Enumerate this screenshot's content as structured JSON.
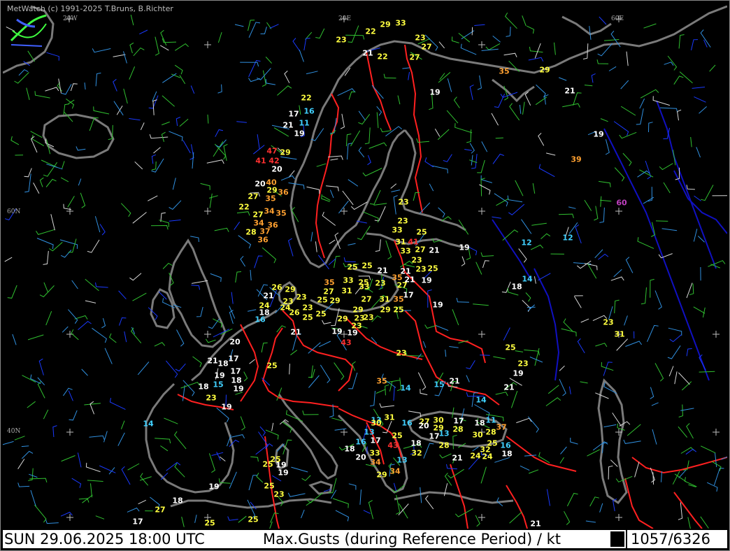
{
  "app": {
    "credit": "MetWatch  (c) 1991-2025 T.Bruns, B.Richter"
  },
  "footer": {
    "datetime": "SUN 29.06.2025 18:00 UTC",
    "parameter": "Max.Gusts (during Reference Period) / kt",
    "count": "1057/6326"
  },
  "grid_labels": {
    "lon_20w": "20W",
    "lon_20e": "20E",
    "lon_60e": "60E",
    "lat_60n": "60N",
    "lat_40n": "40N"
  },
  "colors": {
    "white": "#ffffff",
    "yellow": "#ffff40",
    "orange": "#ffa030",
    "red": "#ff3030",
    "cyan": "#40d0ff",
    "purple": "#c040c0",
    "border_red": "#ff2020",
    "coast": "#808080",
    "shore_blue": "#1010c0"
  },
  "observations": [
    {
      "v": "23",
      "c": "yellow"
    },
    {
      "v": "22",
      "c": "yellow"
    },
    {
      "v": "29",
      "c": "yellow"
    },
    {
      "v": "33",
      "c": "yellow"
    },
    {
      "v": "23",
      "c": "yellow"
    },
    {
      "v": "27",
      "c": "yellow"
    },
    {
      "v": "21",
      "c": "white"
    },
    {
      "v": "22",
      "c": "yellow"
    },
    {
      "v": "27",
      "c": "yellow"
    },
    {
      "v": "35",
      "c": "orange"
    },
    {
      "v": "29",
      "c": "yellow"
    },
    {
      "v": "21",
      "c": "white"
    },
    {
      "v": "19",
      "c": "white"
    },
    {
      "v": "22",
      "c": "yellow"
    },
    {
      "v": "17",
      "c": "white"
    },
    {
      "v": "16",
      "c": "cyan"
    },
    {
      "v": "21",
      "c": "white"
    },
    {
      "v": "11",
      "c": "cyan"
    },
    {
      "v": "19",
      "c": "white"
    },
    {
      "v": "19",
      "c": "white"
    },
    {
      "v": "47",
      "c": "red"
    },
    {
      "v": "29",
      "c": "yellow"
    },
    {
      "v": "41",
      "c": "red"
    },
    {
      "v": "42",
      "c": "red"
    },
    {
      "v": "20",
      "c": "white"
    },
    {
      "v": "39",
      "c": "orange"
    },
    {
      "v": "20",
      "c": "white"
    },
    {
      "v": "40",
      "c": "orange"
    },
    {
      "v": "29",
      "c": "yellow"
    },
    {
      "v": "36",
      "c": "orange"
    },
    {
      "v": "27",
      "c": "yellow"
    },
    {
      "v": "35",
      "c": "orange"
    },
    {
      "v": "22",
      "c": "yellow"
    },
    {
      "v": "34",
      "c": "orange"
    },
    {
      "v": "35",
      "c": "orange"
    },
    {
      "v": "60",
      "c": "purple"
    },
    {
      "v": "27",
      "c": "yellow"
    },
    {
      "v": "23",
      "c": "yellow"
    },
    {
      "v": "34",
      "c": "orange"
    },
    {
      "v": "36",
      "c": "orange"
    },
    {
      "v": "23",
      "c": "yellow"
    },
    {
      "v": "28",
      "c": "yellow"
    },
    {
      "v": "37",
      "c": "orange"
    },
    {
      "v": "33",
      "c": "yellow"
    },
    {
      "v": "25",
      "c": "yellow"
    },
    {
      "v": "36",
      "c": "orange"
    },
    {
      "v": "31",
      "c": "yellow"
    },
    {
      "v": "41",
      "c": "red"
    },
    {
      "v": "33",
      "c": "yellow"
    },
    {
      "v": "27",
      "c": "yellow"
    },
    {
      "v": "21",
      "c": "white"
    },
    {
      "v": "19",
      "c": "white"
    },
    {
      "v": "12",
      "c": "cyan"
    },
    {
      "v": "12",
      "c": "cyan"
    },
    {
      "v": "23",
      "c": "yellow"
    },
    {
      "v": "25",
      "c": "yellow"
    },
    {
      "v": "25",
      "c": "yellow"
    },
    {
      "v": "25",
      "c": "yellow"
    },
    {
      "v": "21",
      "c": "white"
    },
    {
      "v": "21",
      "c": "white"
    },
    {
      "v": "23",
      "c": "yellow"
    },
    {
      "v": "35",
      "c": "orange"
    },
    {
      "v": "33",
      "c": "yellow"
    },
    {
      "v": "25",
      "c": "yellow"
    },
    {
      "v": "35",
      "c": "orange"
    },
    {
      "v": "21",
      "c": "white"
    },
    {
      "v": "19",
      "c": "white"
    },
    {
      "v": "14",
      "c": "cyan"
    },
    {
      "v": "27",
      "c": "yellow"
    },
    {
      "v": "31",
      "c": "yellow"
    },
    {
      "v": "33",
      "c": "yellow"
    },
    {
      "v": "23",
      "c": "yellow"
    },
    {
      "v": "27",
      "c": "yellow"
    },
    {
      "v": "18",
      "c": "white"
    },
    {
      "v": "21",
      "c": "white"
    },
    {
      "v": "26",
      "c": "yellow"
    },
    {
      "v": "29",
      "c": "yellow"
    },
    {
      "v": "23",
      "c": "yellow"
    },
    {
      "v": "25",
      "c": "yellow"
    },
    {
      "v": "29",
      "c": "yellow"
    },
    {
      "v": "27",
      "c": "yellow"
    },
    {
      "v": "31",
      "c": "yellow"
    },
    {
      "v": "35",
      "c": "orange"
    },
    {
      "v": "17",
      "c": "white"
    },
    {
      "v": "24",
      "c": "yellow"
    },
    {
      "v": "23",
      "c": "yellow"
    },
    {
      "v": "23",
      "c": "yellow"
    },
    {
      "v": "29",
      "c": "yellow"
    },
    {
      "v": "29",
      "c": "yellow"
    },
    {
      "v": "25",
      "c": "yellow"
    },
    {
      "v": "19",
      "c": "white"
    },
    {
      "v": "18",
      "c": "white"
    },
    {
      "v": "24",
      "c": "yellow"
    },
    {
      "v": "26",
      "c": "yellow"
    },
    {
      "v": "25",
      "c": "yellow"
    },
    {
      "v": "25",
      "c": "yellow"
    },
    {
      "v": "23",
      "c": "yellow"
    },
    {
      "v": "23",
      "c": "yellow"
    },
    {
      "v": "16",
      "c": "cyan"
    },
    {
      "v": "29",
      "c": "yellow"
    },
    {
      "v": "23",
      "c": "yellow"
    },
    {
      "v": "19",
      "c": "white"
    },
    {
      "v": "19",
      "c": "white"
    },
    {
      "v": "23",
      "c": "yellow"
    },
    {
      "v": "31",
      "c": "yellow"
    },
    {
      "v": "21",
      "c": "white"
    },
    {
      "v": "20",
      "c": "white"
    },
    {
      "v": "43",
      "c": "red"
    },
    {
      "v": "25",
      "c": "yellow"
    },
    {
      "v": "17",
      "c": "white"
    },
    {
      "v": "23",
      "c": "yellow"
    },
    {
      "v": "23",
      "c": "yellow"
    },
    {
      "v": "21",
      "c": "white"
    },
    {
      "v": "18",
      "c": "white"
    },
    {
      "v": "25",
      "c": "yellow"
    },
    {
      "v": "19",
      "c": "white"
    },
    {
      "v": "17",
      "c": "white"
    },
    {
      "v": "18",
      "c": "white"
    },
    {
      "v": "19",
      "c": "white"
    },
    {
      "v": "35",
      "c": "orange"
    },
    {
      "v": "21",
      "c": "white"
    },
    {
      "v": "21",
      "c": "white"
    },
    {
      "v": "18",
      "c": "white"
    },
    {
      "v": "15",
      "c": "cyan"
    },
    {
      "v": "19",
      "c": "white"
    },
    {
      "v": "14",
      "c": "cyan"
    },
    {
      "v": "15",
      "c": "cyan"
    },
    {
      "v": "23",
      "c": "yellow"
    },
    {
      "v": "19",
      "c": "white"
    },
    {
      "v": "14",
      "c": "cyan"
    },
    {
      "v": "14",
      "c": "cyan"
    },
    {
      "v": "31",
      "c": "yellow"
    },
    {
      "v": "13",
      "c": "cyan"
    },
    {
      "v": "16",
      "c": "cyan"
    },
    {
      "v": "27",
      "c": "yellow"
    },
    {
      "v": "30",
      "c": "yellow"
    },
    {
      "v": "17",
      "c": "white"
    },
    {
      "v": "18",
      "c": "white"
    },
    {
      "v": "11",
      "c": "cyan"
    },
    {
      "v": "30",
      "c": "yellow"
    },
    {
      "v": "20",
      "c": "white"
    },
    {
      "v": "29",
      "c": "yellow"
    },
    {
      "v": "28",
      "c": "yellow"
    },
    {
      "v": "37",
      "c": "orange"
    },
    {
      "v": "13",
      "c": "cyan"
    },
    {
      "v": "25",
      "c": "yellow"
    },
    {
      "v": "13",
      "c": "cyan"
    },
    {
      "v": "30",
      "c": "yellow"
    },
    {
      "v": "28",
      "c": "yellow"
    },
    {
      "v": "16",
      "c": "cyan"
    },
    {
      "v": "17",
      "c": "white"
    },
    {
      "v": "17",
      "c": "white"
    },
    {
      "v": "18",
      "c": "white"
    },
    {
      "v": "25",
      "c": "yellow"
    },
    {
      "v": "16",
      "c": "cyan"
    },
    {
      "v": "18",
      "c": "white"
    },
    {
      "v": "43",
      "c": "red"
    },
    {
      "v": "28",
      "c": "yellow"
    },
    {
      "v": "32",
      "c": "yellow"
    },
    {
      "v": "18",
      "c": "white"
    },
    {
      "v": "32",
      "c": "yellow"
    },
    {
      "v": "33",
      "c": "yellow"
    },
    {
      "v": "20",
      "c": "white"
    },
    {
      "v": "21",
      "c": "white"
    },
    {
      "v": "24",
      "c": "yellow"
    },
    {
      "v": "24",
      "c": "yellow"
    },
    {
      "v": "13",
      "c": "cyan"
    },
    {
      "v": "34",
      "c": "orange"
    },
    {
      "v": "34",
      "c": "orange"
    },
    {
      "v": "29",
      "c": "yellow"
    },
    {
      "v": "25",
      "c": "yellow"
    },
    {
      "v": "25",
      "c": "yellow"
    },
    {
      "v": "19",
      "c": "white"
    },
    {
      "v": "19",
      "c": "white"
    },
    {
      "v": "19",
      "c": "white"
    },
    {
      "v": "25",
      "c": "yellow"
    },
    {
      "v": "23",
      "c": "yellow"
    },
    {
      "v": "18",
      "c": "white"
    },
    {
      "v": "27",
      "c": "yellow"
    },
    {
      "v": "17",
      "c": "white"
    },
    {
      "v": "25",
      "c": "yellow"
    },
    {
      "v": "25",
      "c": "yellow"
    },
    {
      "v": "21",
      "c": "white"
    }
  ]
}
